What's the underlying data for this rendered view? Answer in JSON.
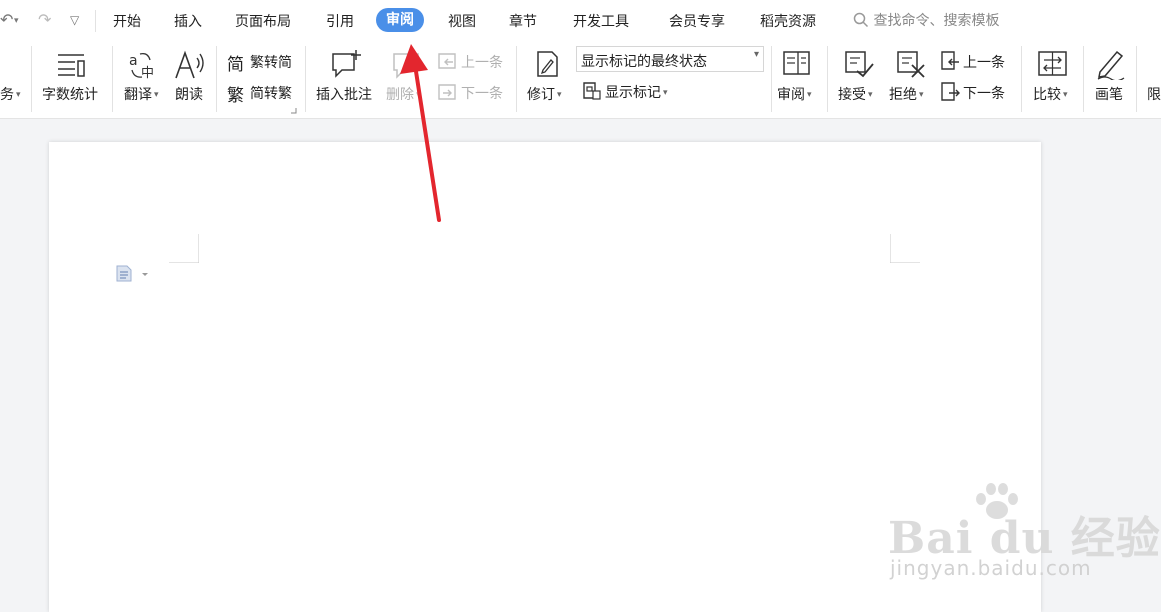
{
  "menubar": {
    "tabs": [
      {
        "label": "开始",
        "active": false
      },
      {
        "label": "插入",
        "active": false
      },
      {
        "label": "页面布局",
        "active": false
      },
      {
        "label": "引用",
        "active": false
      },
      {
        "label": "审阅",
        "active": true
      },
      {
        "label": "视图",
        "active": false
      },
      {
        "label": "章节",
        "active": false
      },
      {
        "label": "开发工具",
        "active": false
      },
      {
        "label": "会员专享",
        "active": false
      },
      {
        "label": "稻壳资源",
        "active": false
      }
    ],
    "search_placeholder": "查找命令、搜索模板"
  },
  "ribbon": {
    "task_partial": "务",
    "word_count": "字数统计",
    "translate": "翻译",
    "read_aloud": "朗读",
    "trad_to_simp": "繁转简",
    "simp_to_trad": "简转繁",
    "insert_comment": "插入批注",
    "delete_comment": "删除",
    "prev_comment": "上一条",
    "next_comment": "下一条",
    "track_changes": "修订",
    "markup_state": "显示标记的最终状态",
    "show_markup": "显示标记",
    "reviewing_pane": "审阅",
    "accept": "接受",
    "reject": "拒绝",
    "prev_change": "上一条",
    "next_change": "下一条",
    "compare": "比较",
    "ink": "画笔",
    "restrict_partial": "限"
  },
  "watermark": {
    "main": "Bai du 经验",
    "sub": "jingyan.baidu.com"
  },
  "colors": {
    "accent": "#4a8fe8",
    "arrow": "#e3262e",
    "background": "#f3f4f6"
  }
}
